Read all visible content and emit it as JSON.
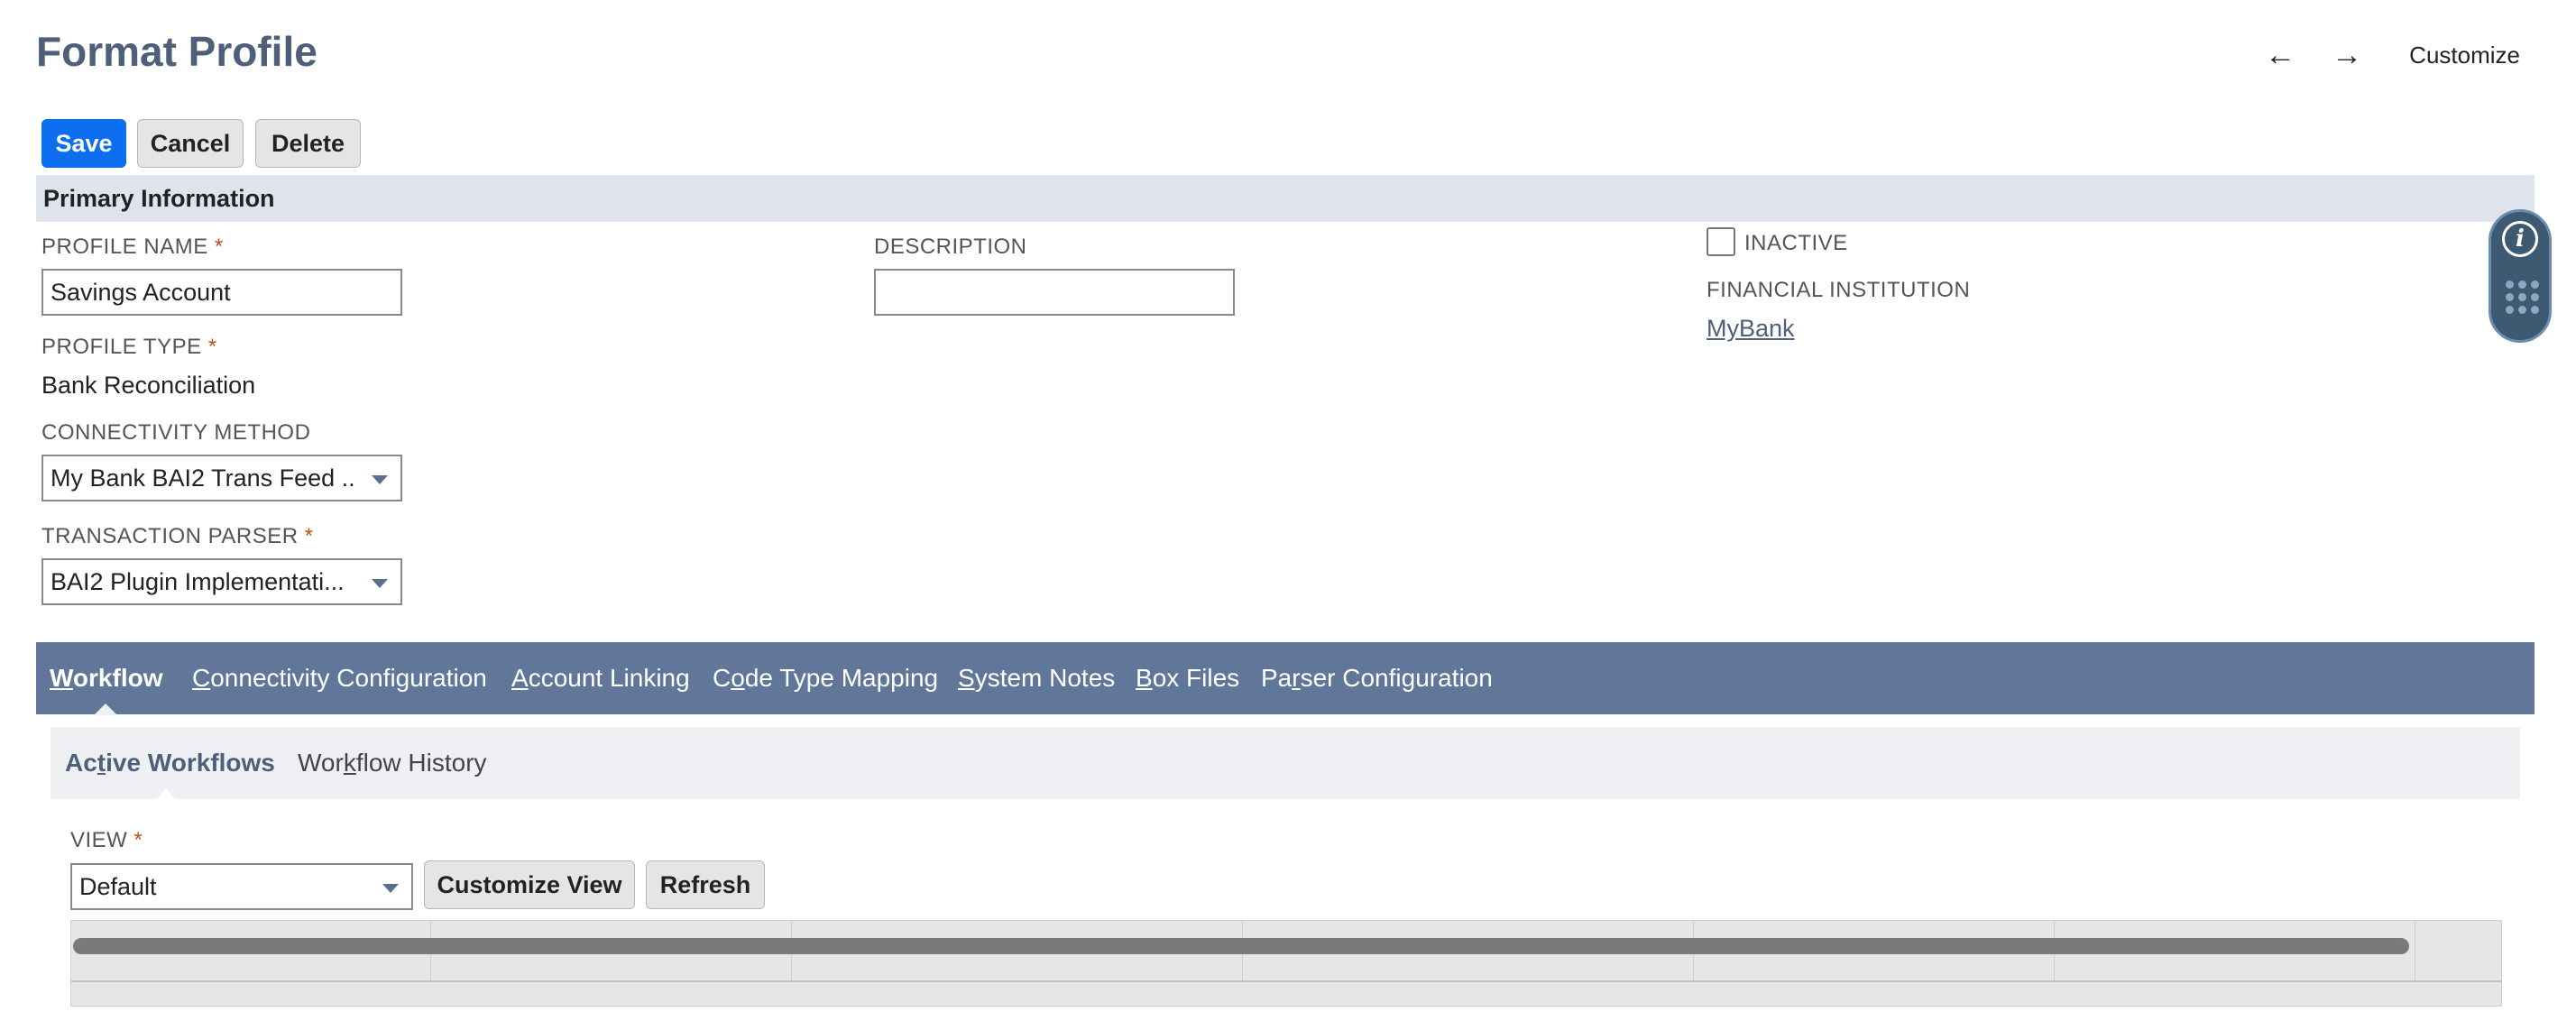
{
  "page": {
    "title": "Format Profile"
  },
  "top_nav": {
    "back_icon": "left-arrow-icon",
    "forward_icon": "right-arrow-icon",
    "customize_label": "Customize"
  },
  "buttons": {
    "save": "Save",
    "cancel": "Cancel",
    "delete": "Delete"
  },
  "section": {
    "primary_info": "Primary Information"
  },
  "fields": {
    "profile_name": {
      "label": "PROFILE NAME",
      "required_mark": "*",
      "value": "Savings Account"
    },
    "description": {
      "label": "DESCRIPTION",
      "value": ""
    },
    "inactive": {
      "label": "INACTIVE",
      "checked": false
    },
    "financial_institution": {
      "label": "FINANCIAL INSTITUTION",
      "value": "MyBank"
    },
    "profile_type": {
      "label": "PROFILE TYPE",
      "required_mark": "*",
      "value": "Bank Reconciliation"
    },
    "connectivity_method": {
      "label": "CONNECTIVITY METHOD",
      "value": "My Bank BAI2 Trans Feed ..."
    },
    "transaction_parser": {
      "label": "TRANSACTION PARSER",
      "required_mark": "*",
      "value": "BAI2 Plugin Implementati..."
    }
  },
  "side_widget": {
    "info_icon": "info-icon",
    "apps_icon": "apps-grid-icon"
  },
  "tabs": [
    {
      "u": "W",
      "rest": "orkflow",
      "active": true
    },
    {
      "u": "C",
      "rest": "onnectivity Configuration"
    },
    {
      "u": "A",
      "rest": "ccount Linking"
    },
    {
      "pre": "C",
      "u": "o",
      "rest": "de Type Mapping"
    },
    {
      "u": "S",
      "rest": "ystem Notes"
    },
    {
      "u": "B",
      "rest": "ox Files"
    },
    {
      "pre": "Pa",
      "u": "r",
      "rest": "ser Configuration"
    }
  ],
  "subtabs": [
    {
      "pre": "Ac",
      "u": "t",
      "rest": "ive Workflows",
      "active": true
    },
    {
      "pre": "Wor",
      "u": "k",
      "rest": "flow History"
    }
  ],
  "view": {
    "label": "VIEW",
    "required_mark": "*",
    "value": "Default",
    "customize_view": "Customize View",
    "refresh": "Refresh"
  },
  "colors": {
    "accent": "#0e6ef0",
    "tab_bar": "#607799",
    "section_bar": "#dfe4ec",
    "title": "#4d5f79",
    "required": "#b5531b"
  }
}
